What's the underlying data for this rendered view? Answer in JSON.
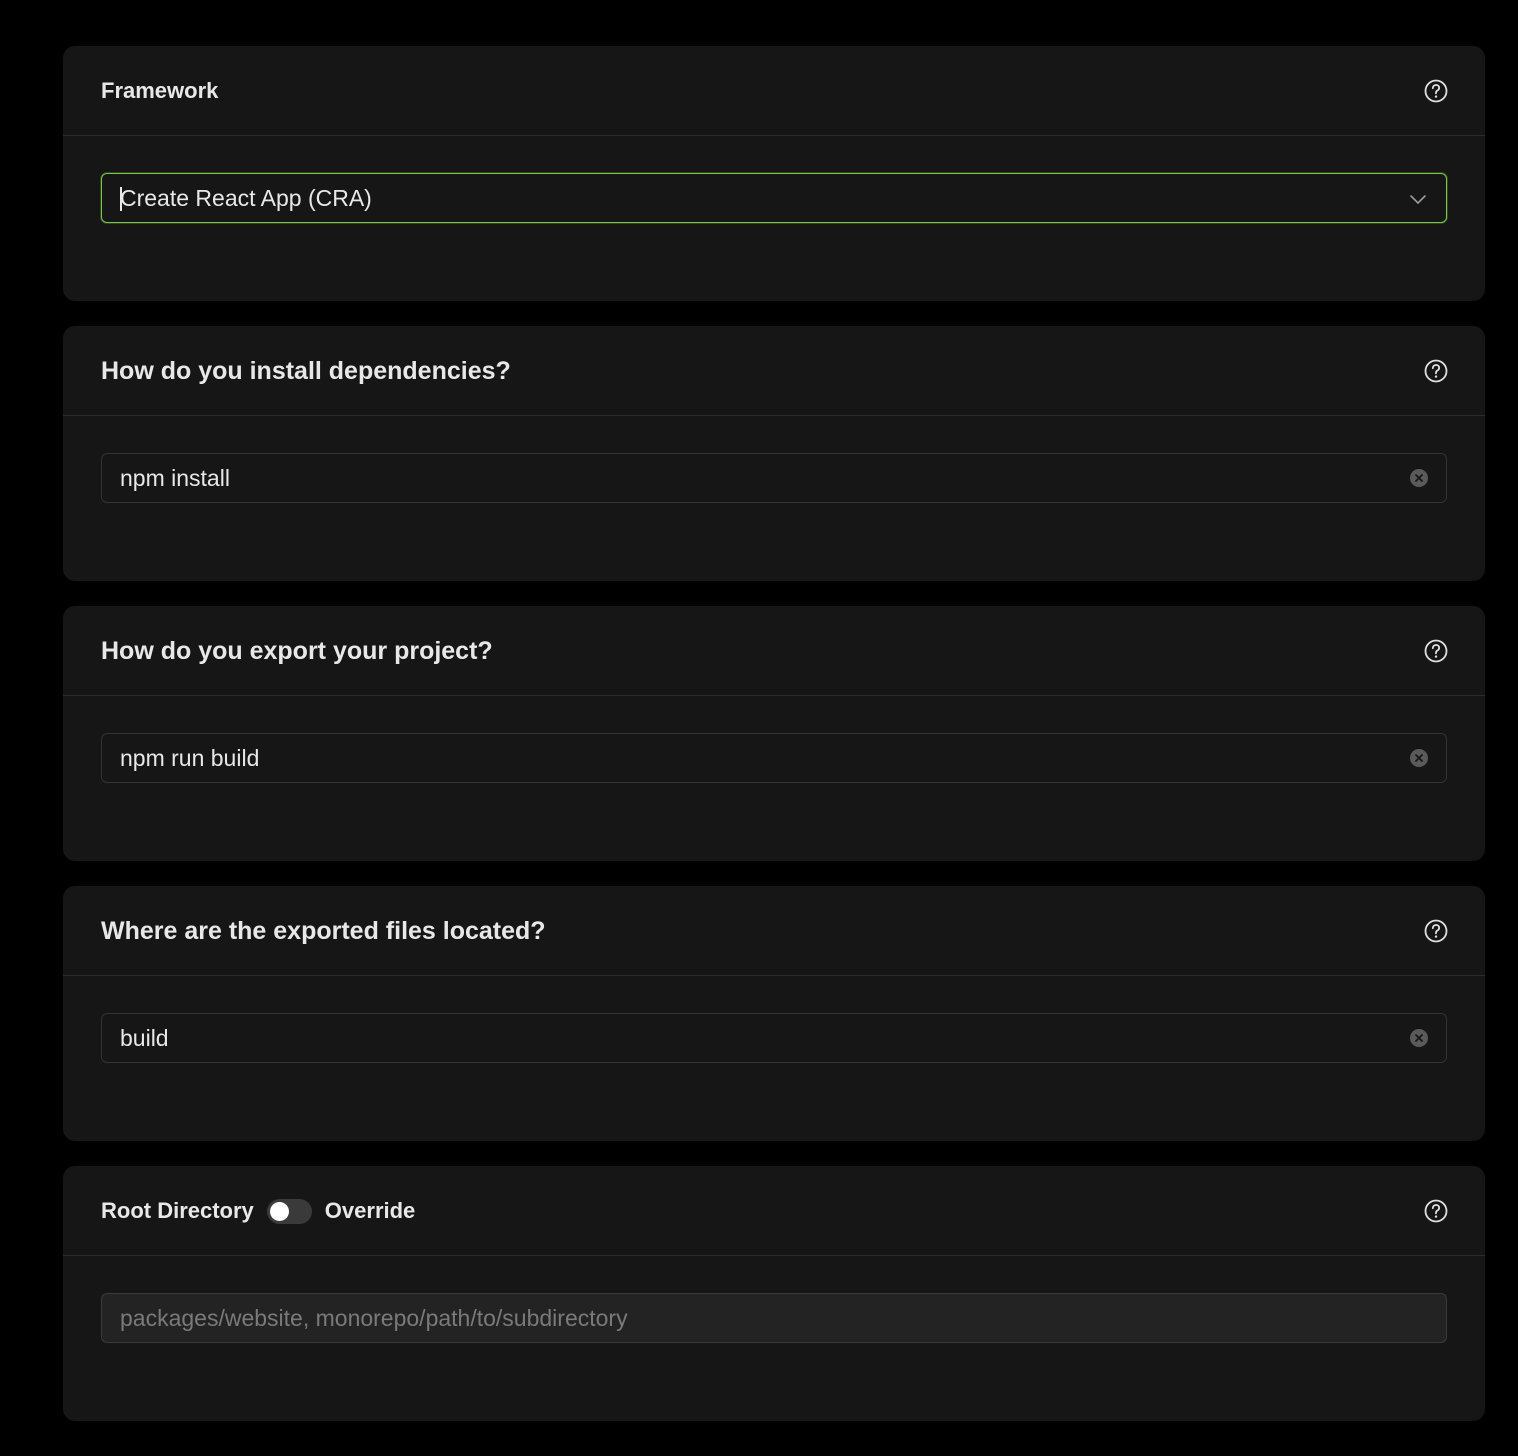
{
  "colors": {
    "page_background": "#000000",
    "card_background": "#161616",
    "divider": "#2a2a2a",
    "focus_border": "#79c949",
    "text": "#e8e8e8",
    "placeholder": "#7a7a7a"
  },
  "framework": {
    "title": "Framework",
    "help_icon": "question-circle-icon",
    "selected_value": "Create React App (CRA)",
    "dropdown_icon": "chevron-down-icon"
  },
  "install": {
    "title": "How do you install dependencies?",
    "help_icon": "question-circle-icon",
    "value": "npm install",
    "clear_icon": "clear-circle-icon"
  },
  "export": {
    "title": "How do you export your project?",
    "help_icon": "question-circle-icon",
    "value": "npm run build",
    "clear_icon": "clear-circle-icon"
  },
  "output": {
    "title": "Where are the exported files located?",
    "help_icon": "question-circle-icon",
    "value": "build",
    "clear_icon": "clear-circle-icon"
  },
  "root_directory": {
    "title": "Root Directory",
    "override_label": "Override",
    "override_enabled": false,
    "help_icon": "question-circle-icon",
    "placeholder": "packages/website, monorepo/path/to/subdirectory",
    "value": ""
  }
}
